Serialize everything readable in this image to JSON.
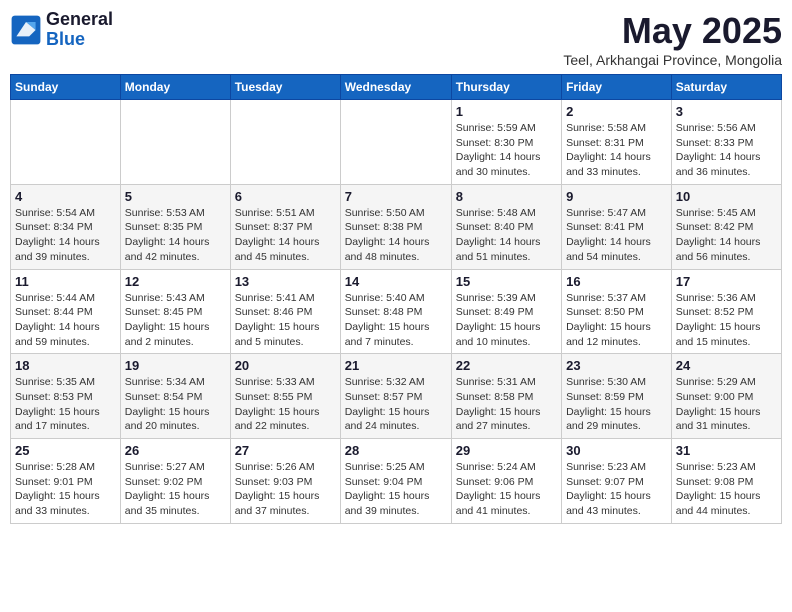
{
  "logo": {
    "general": "General",
    "blue": "Blue"
  },
  "title": "May 2025",
  "subtitle": "Teel, Arkhangai Province, Mongolia",
  "weekdays": [
    "Sunday",
    "Monday",
    "Tuesday",
    "Wednesday",
    "Thursday",
    "Friday",
    "Saturday"
  ],
  "weeks": [
    [
      {
        "day": "",
        "info": ""
      },
      {
        "day": "",
        "info": ""
      },
      {
        "day": "",
        "info": ""
      },
      {
        "day": "",
        "info": ""
      },
      {
        "day": "1",
        "info": "Sunrise: 5:59 AM\nSunset: 8:30 PM\nDaylight: 14 hours\nand 30 minutes."
      },
      {
        "day": "2",
        "info": "Sunrise: 5:58 AM\nSunset: 8:31 PM\nDaylight: 14 hours\nand 33 minutes."
      },
      {
        "day": "3",
        "info": "Sunrise: 5:56 AM\nSunset: 8:33 PM\nDaylight: 14 hours\nand 36 minutes."
      }
    ],
    [
      {
        "day": "4",
        "info": "Sunrise: 5:54 AM\nSunset: 8:34 PM\nDaylight: 14 hours\nand 39 minutes."
      },
      {
        "day": "5",
        "info": "Sunrise: 5:53 AM\nSunset: 8:35 PM\nDaylight: 14 hours\nand 42 minutes."
      },
      {
        "day": "6",
        "info": "Sunrise: 5:51 AM\nSunset: 8:37 PM\nDaylight: 14 hours\nand 45 minutes."
      },
      {
        "day": "7",
        "info": "Sunrise: 5:50 AM\nSunset: 8:38 PM\nDaylight: 14 hours\nand 48 minutes."
      },
      {
        "day": "8",
        "info": "Sunrise: 5:48 AM\nSunset: 8:40 PM\nDaylight: 14 hours\nand 51 minutes."
      },
      {
        "day": "9",
        "info": "Sunrise: 5:47 AM\nSunset: 8:41 PM\nDaylight: 14 hours\nand 54 minutes."
      },
      {
        "day": "10",
        "info": "Sunrise: 5:45 AM\nSunset: 8:42 PM\nDaylight: 14 hours\nand 56 minutes."
      }
    ],
    [
      {
        "day": "11",
        "info": "Sunrise: 5:44 AM\nSunset: 8:44 PM\nDaylight: 14 hours\nand 59 minutes."
      },
      {
        "day": "12",
        "info": "Sunrise: 5:43 AM\nSunset: 8:45 PM\nDaylight: 15 hours\nand 2 minutes."
      },
      {
        "day": "13",
        "info": "Sunrise: 5:41 AM\nSunset: 8:46 PM\nDaylight: 15 hours\nand 5 minutes."
      },
      {
        "day": "14",
        "info": "Sunrise: 5:40 AM\nSunset: 8:48 PM\nDaylight: 15 hours\nand 7 minutes."
      },
      {
        "day": "15",
        "info": "Sunrise: 5:39 AM\nSunset: 8:49 PM\nDaylight: 15 hours\nand 10 minutes."
      },
      {
        "day": "16",
        "info": "Sunrise: 5:37 AM\nSunset: 8:50 PM\nDaylight: 15 hours\nand 12 minutes."
      },
      {
        "day": "17",
        "info": "Sunrise: 5:36 AM\nSunset: 8:52 PM\nDaylight: 15 hours\nand 15 minutes."
      }
    ],
    [
      {
        "day": "18",
        "info": "Sunrise: 5:35 AM\nSunset: 8:53 PM\nDaylight: 15 hours\nand 17 minutes."
      },
      {
        "day": "19",
        "info": "Sunrise: 5:34 AM\nSunset: 8:54 PM\nDaylight: 15 hours\nand 20 minutes."
      },
      {
        "day": "20",
        "info": "Sunrise: 5:33 AM\nSunset: 8:55 PM\nDaylight: 15 hours\nand 22 minutes."
      },
      {
        "day": "21",
        "info": "Sunrise: 5:32 AM\nSunset: 8:57 PM\nDaylight: 15 hours\nand 24 minutes."
      },
      {
        "day": "22",
        "info": "Sunrise: 5:31 AM\nSunset: 8:58 PM\nDaylight: 15 hours\nand 27 minutes."
      },
      {
        "day": "23",
        "info": "Sunrise: 5:30 AM\nSunset: 8:59 PM\nDaylight: 15 hours\nand 29 minutes."
      },
      {
        "day": "24",
        "info": "Sunrise: 5:29 AM\nSunset: 9:00 PM\nDaylight: 15 hours\nand 31 minutes."
      }
    ],
    [
      {
        "day": "25",
        "info": "Sunrise: 5:28 AM\nSunset: 9:01 PM\nDaylight: 15 hours\nand 33 minutes."
      },
      {
        "day": "26",
        "info": "Sunrise: 5:27 AM\nSunset: 9:02 PM\nDaylight: 15 hours\nand 35 minutes."
      },
      {
        "day": "27",
        "info": "Sunrise: 5:26 AM\nSunset: 9:03 PM\nDaylight: 15 hours\nand 37 minutes."
      },
      {
        "day": "28",
        "info": "Sunrise: 5:25 AM\nSunset: 9:04 PM\nDaylight: 15 hours\nand 39 minutes."
      },
      {
        "day": "29",
        "info": "Sunrise: 5:24 AM\nSunset: 9:06 PM\nDaylight: 15 hours\nand 41 minutes."
      },
      {
        "day": "30",
        "info": "Sunrise: 5:23 AM\nSunset: 9:07 PM\nDaylight: 15 hours\nand 43 minutes."
      },
      {
        "day": "31",
        "info": "Sunrise: 5:23 AM\nSunset: 9:08 PM\nDaylight: 15 hours\nand 44 minutes."
      }
    ]
  ]
}
